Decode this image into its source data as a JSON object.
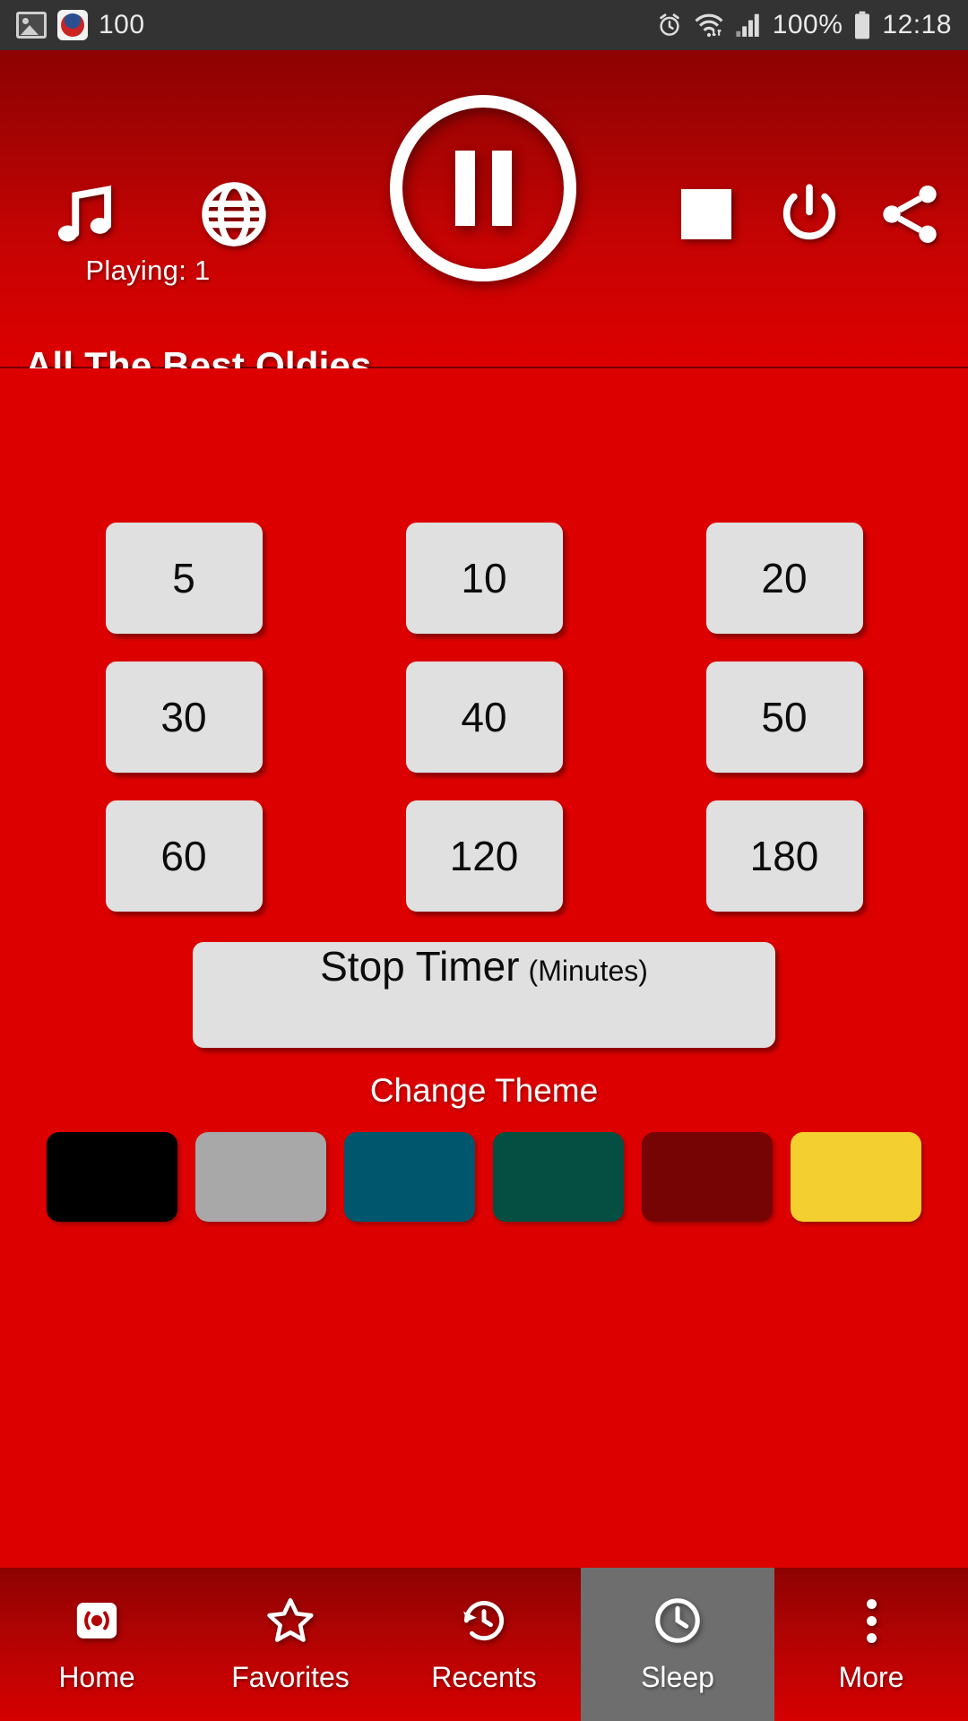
{
  "status_bar": {
    "left_icons": [
      "gallery-icon",
      "nonstop-music-app-icon"
    ],
    "notification_count": "100",
    "right_icons": [
      "alarm-icon",
      "wifi-icon",
      "signal-icon",
      "battery-icon"
    ],
    "battery_percent": "100%",
    "time": "12:18"
  },
  "header": {
    "music_icon": "music-note-icon",
    "globe_icon": "globe-icon",
    "playing_label": "Playing: 1",
    "play_pause_icon": "pause-icon",
    "stop_icon": "stop-icon",
    "power_icon": "power-icon",
    "share_icon": "share-icon",
    "station_title": "All The Best Oldies"
  },
  "sleep_timer": {
    "rows": [
      [
        "5",
        "10",
        "20"
      ],
      [
        "30",
        "40",
        "50"
      ],
      [
        "60",
        "120",
        "180"
      ]
    ],
    "stop_timer_label": "Stop Timer",
    "stop_timer_unit": "(Minutes)"
  },
  "theme": {
    "label": "Change Theme",
    "swatches": [
      {
        "name": "black",
        "color": "#000000"
      },
      {
        "name": "gray",
        "color": "#a8a8a8"
      },
      {
        "name": "teal-blue",
        "color": "#00566c"
      },
      {
        "name": "dark-green",
        "color": "#044f41"
      },
      {
        "name": "dark-red",
        "color": "#760404"
      },
      {
        "name": "yellow",
        "color": "#f3d030"
      }
    ]
  },
  "bottom_nav": {
    "items": [
      {
        "label": "Home",
        "icon": "broadcast-icon",
        "active": false
      },
      {
        "label": "Favorites",
        "icon": "star-icon",
        "active": false
      },
      {
        "label": "Recents",
        "icon": "history-icon",
        "active": false
      },
      {
        "label": "Sleep",
        "icon": "clock-icon",
        "active": true
      },
      {
        "label": "More",
        "icon": "overflow-dots-icon",
        "active": false
      }
    ]
  },
  "colors": {
    "body_red": "#dd0000",
    "header_dark": "#8d0202",
    "status_bar": "#333333",
    "button_gray": "#e0e0e0",
    "nav_active": "#6e6e6e"
  }
}
